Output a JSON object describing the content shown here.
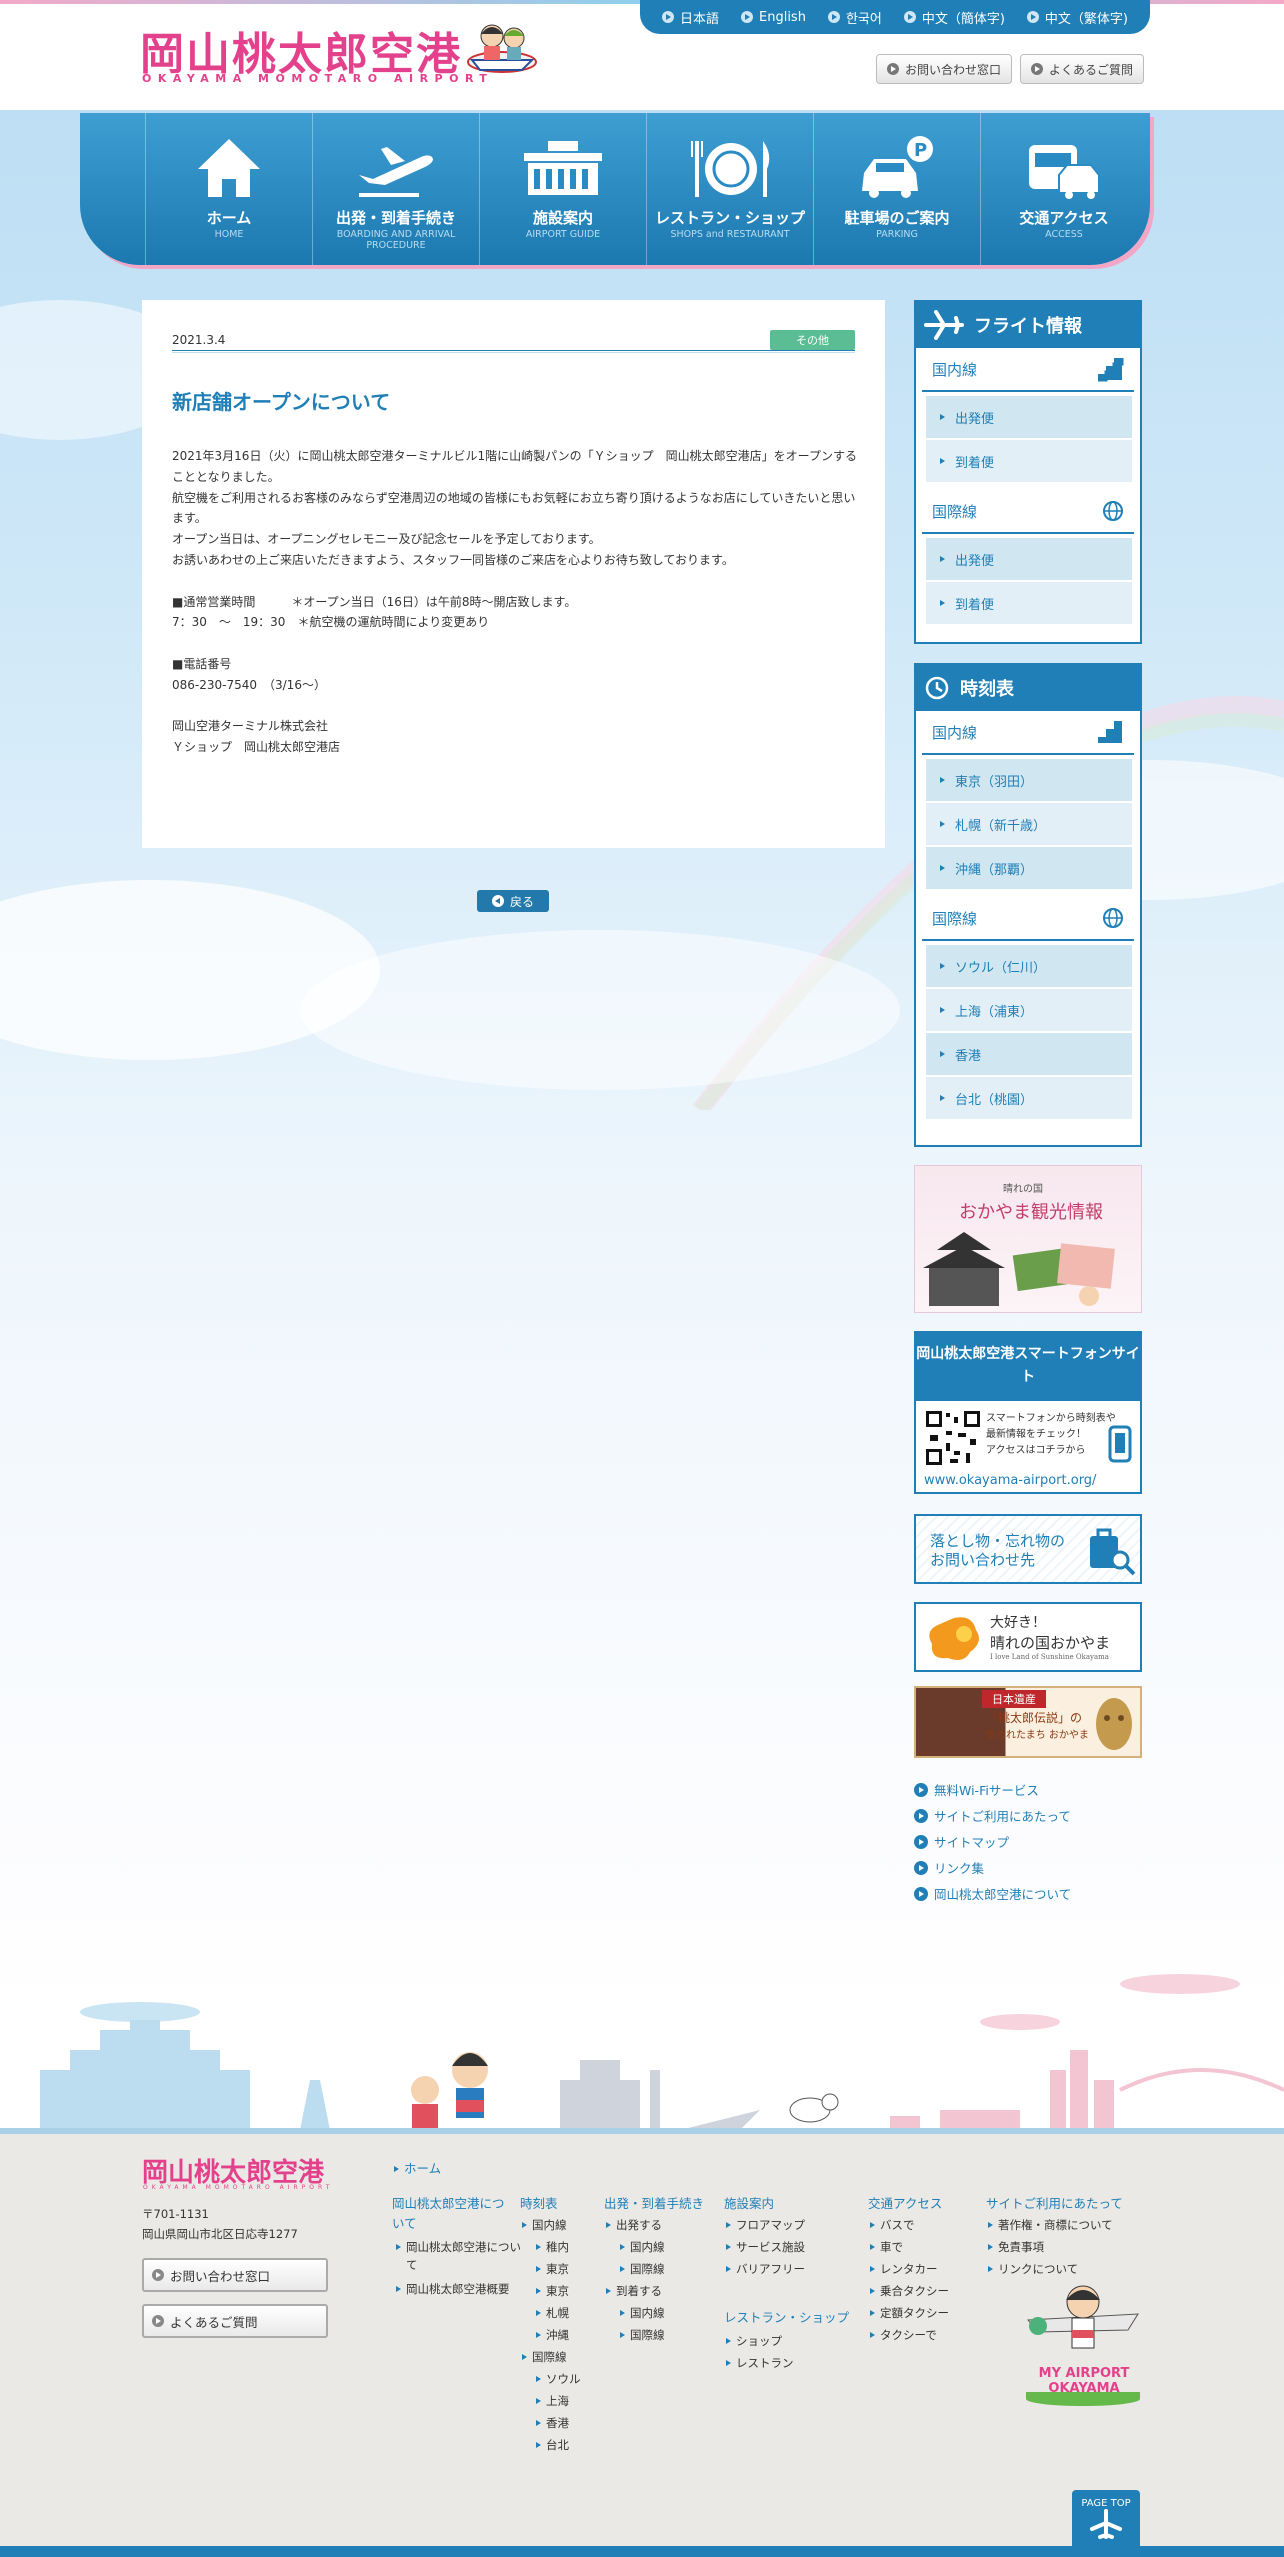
{
  "header": {
    "logo_title": "岡山桃太郎空港",
    "logo_sub": "OKAYAMA MOMOTARO AIRPORT",
    "languages": [
      "日本語",
      "English",
      "한국어",
      "中文（簡体字)",
      "中文（繁体字)"
    ],
    "contact_label": "お問い合わせ窓口",
    "faq_label": "よくあるご質問"
  },
  "nav": {
    "items": [
      {
        "label": "ホーム",
        "en": "HOME",
        "icon": "home-icon"
      },
      {
        "label": "出発・到着手続き",
        "en": "BOARDING AND ARRIVAL PROCEDURE",
        "icon": "plane-departure-icon"
      },
      {
        "label": "施設案内",
        "en": "AIRPORT GUIDE",
        "icon": "terminal-building-icon"
      },
      {
        "label": "レストラン・ショップ",
        "en": "SHOPS and RESTAURANT",
        "icon": "restaurant-icon"
      },
      {
        "label": "駐車場のご案内",
        "en": "PARKING",
        "icon": "parking-car-icon"
      },
      {
        "label": "交通アクセス",
        "en": "ACCESS",
        "icon": "bus-car-icon"
      }
    ]
  },
  "article": {
    "date": "2021.3.4",
    "category": "その他",
    "title": "新店舗オープンについて",
    "paragraphs": [
      "2021年3月16日（火）に岡山桃太郎空港ターミナルビル1階に山崎製パンの「Ｙショップ　岡山桃太郎空港店」をオープンすることとなりました。",
      "航空機をご利用されるお客様のみならず空港周辺の地域の皆様にもお気軽にお立ち寄り頂けるようなお店にしていきたいと思います。",
      "オープン当日は、オープニングセレモニー及び記念セールを予定しております。",
      "お誘いあわせの上ご来店いただきますよう、スタッフ一同皆様のご来店を心よりお待ち致しております。",
      "",
      "■通常営業時間　　　＊オープン当日（16日）は午前8時～開店致します。",
      "7：30　～　19：30　＊航空機の運航時間により変更あり",
      "",
      "■電話番号",
      "086-230-7540　（3/16～）",
      "",
      "岡山空港ターミナル株式会社",
      "Ｙショップ　岡山桃太郎空港店"
    ],
    "back_label": "戻る"
  },
  "sidebar": {
    "flight": {
      "title": "フライト情報",
      "domestic": "国内線",
      "domestic_items": [
        "出発便",
        "到着便"
      ],
      "international": "国際線",
      "international_items": [
        "出発便",
        "到着便"
      ]
    },
    "timetable": {
      "title": "時刻表",
      "domestic": "国内線",
      "domestic_items": [
        "東京（羽田）",
        "札幌（新千歳）",
        "沖縄（那覇）"
      ],
      "international": "国際線",
      "international_items": [
        "ソウル（仁川）",
        "上海（浦東）",
        "香港",
        "台北（桃園）"
      ]
    },
    "kanko_banner": {
      "small": "晴れの国",
      "title": "おかやま観光情報"
    },
    "smartphone": {
      "title": "岡山桃太郎空港スマートフォンサイト",
      "text": [
        "スマートフォンから時刻表や",
        "最新情報をチェック！",
        "アクセスはコチラから"
      ],
      "url": "www.okayama-airport.org/"
    },
    "lost_banner": [
      "落とし物・忘れ物の",
      "お問い合わせ先"
    ],
    "hare_banner": {
      "line1": "大好き！",
      "line2": "晴れの国おかやま",
      "line3": "I love Land of Sunshine Okayama"
    },
    "heritage_banner": {
      "tag": "日本遺産",
      "line1": "「桃太郎伝説」の",
      "line2": "生まれたまち おかやま"
    },
    "links": [
      "無料Wi-Fiサービス",
      "サイトご利用にあたって",
      "サイトマップ",
      "リンク集",
      "岡山桃太郎空港について"
    ]
  },
  "footer": {
    "logo": "岡山桃太郎空港",
    "logo_sub": "OKAYAMA MOMOTARO AIRPORT",
    "postal": "〒701-1131",
    "address": "岡山県岡山市北区日応寺1277",
    "contact_label": "お問い合わせ窓口",
    "faq_label": "よくあるご質問",
    "home": "ホーム",
    "col_about": {
      "title": "岡山桃太郎空港について",
      "items": [
        "岡山桃太郎空港について",
        "岡山桃太郎空港概要"
      ]
    },
    "col_time": {
      "title": "時刻表",
      "dom": "国内線",
      "dom_items": [
        "稚内",
        "東京",
        "東京",
        "札幌",
        "沖縄"
      ],
      "intl": "国際線",
      "intl_items": [
        "ソウル",
        "上海",
        "香港",
        "台北"
      ]
    },
    "col_dep": {
      "title": "出発・到着手続き",
      "dep": "出発する",
      "dep_items": [
        "国内線",
        "国際線"
      ],
      "arr": "到着する",
      "arr_items": [
        "国内線",
        "国際線"
      ]
    },
    "col_fac": {
      "title": "施設案内",
      "items": [
        "フロアマップ",
        "サービス施設",
        "バリアフリー"
      ],
      "title2": "レストラン・ショップ",
      "items2": [
        "ショップ",
        "レストラン"
      ]
    },
    "col_access": {
      "title": "交通アクセス",
      "items": [
        "バスで",
        "車で",
        "レンタカー",
        "乗合タクシー",
        "定額タクシー",
        "タクシーで"
      ]
    },
    "col_site": {
      "title": "サイトご利用にあたって",
      "items": [
        "著作権・商標について",
        "免責事項",
        "リンクについて"
      ]
    },
    "mascot_text": [
      "MY AIRPORT",
      "OKAYAMA"
    ],
    "pagetop": "PAGE TOP"
  }
}
